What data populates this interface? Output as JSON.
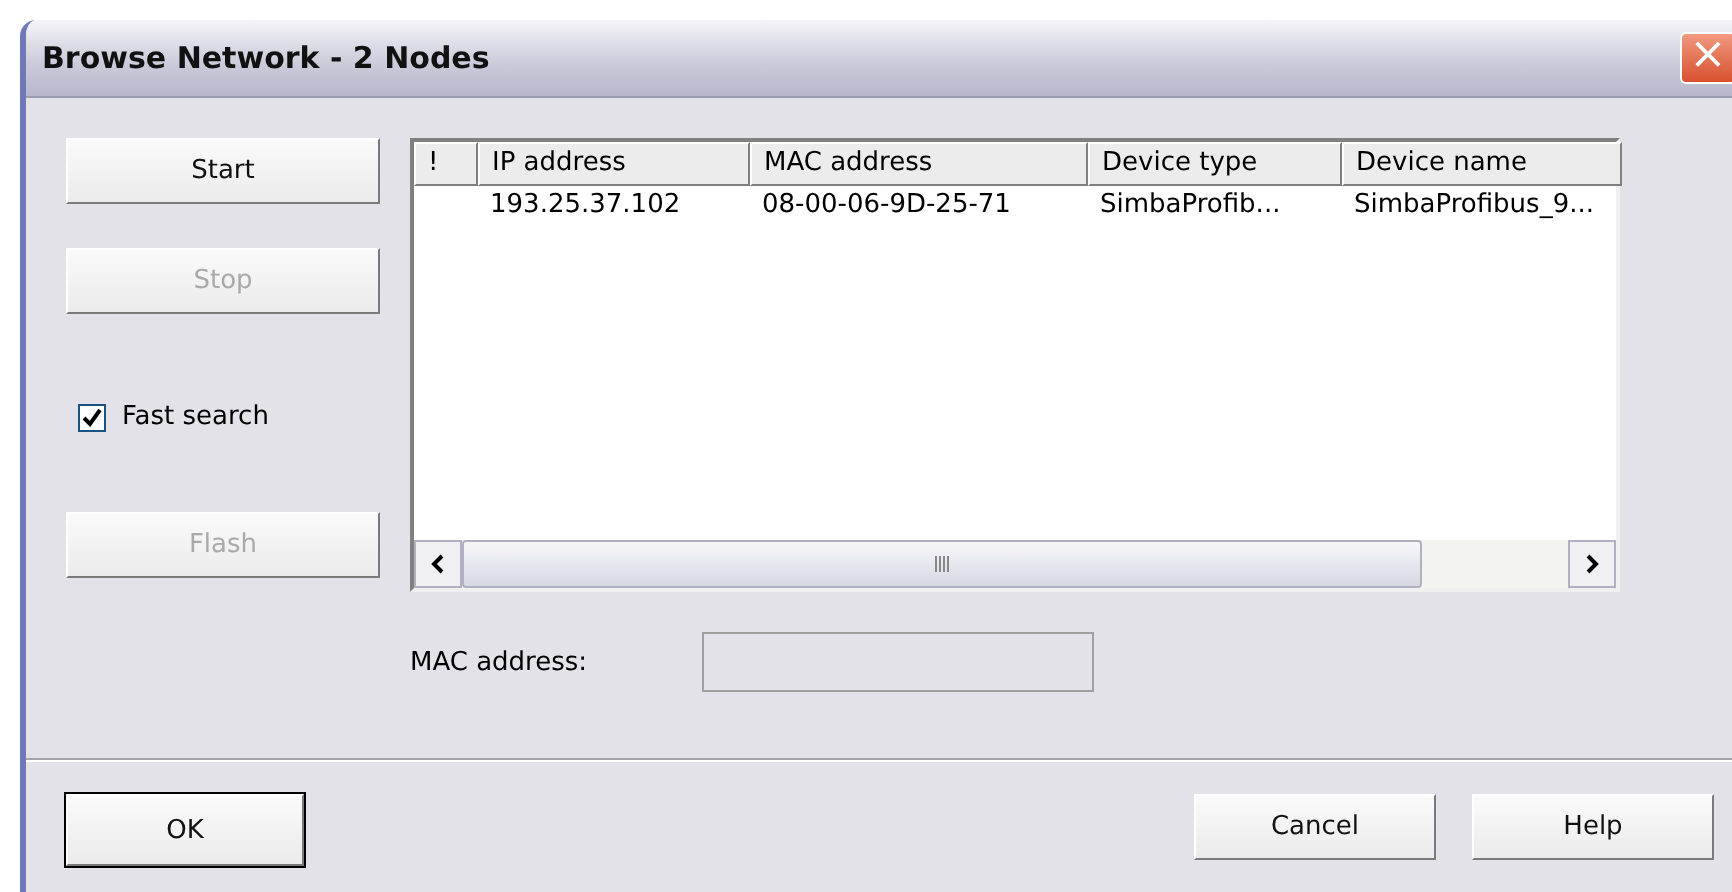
{
  "window": {
    "title": "Browse Network - 2 Nodes",
    "close": "×"
  },
  "side_buttons": [
    {
      "label": "Start",
      "disabled": false
    },
    {
      "label": "Stop",
      "disabled": true
    }
  ],
  "fast_search": {
    "label": "Fast search",
    "checked": true
  },
  "flash_button": {
    "label": "Flash",
    "disabled": true
  },
  "table": {
    "columns": [
      "!",
      "IP address",
      "MAC address",
      "Device type",
      "Device name"
    ],
    "rows": [
      [
        "",
        "193.25.37.102",
        "08-00-06-9D-25-71",
        "SimbaProfib...",
        "SimbaProfibus_9..."
      ]
    ]
  },
  "mac_field": {
    "label": "MAC address:",
    "disabled": true
  },
  "buttons": [
    {
      "label": "OK",
      "default": true
    },
    {
      "label": "Cancel",
      "default": false
    },
    {
      "label": "Help",
      "default": false
    }
  ]
}
